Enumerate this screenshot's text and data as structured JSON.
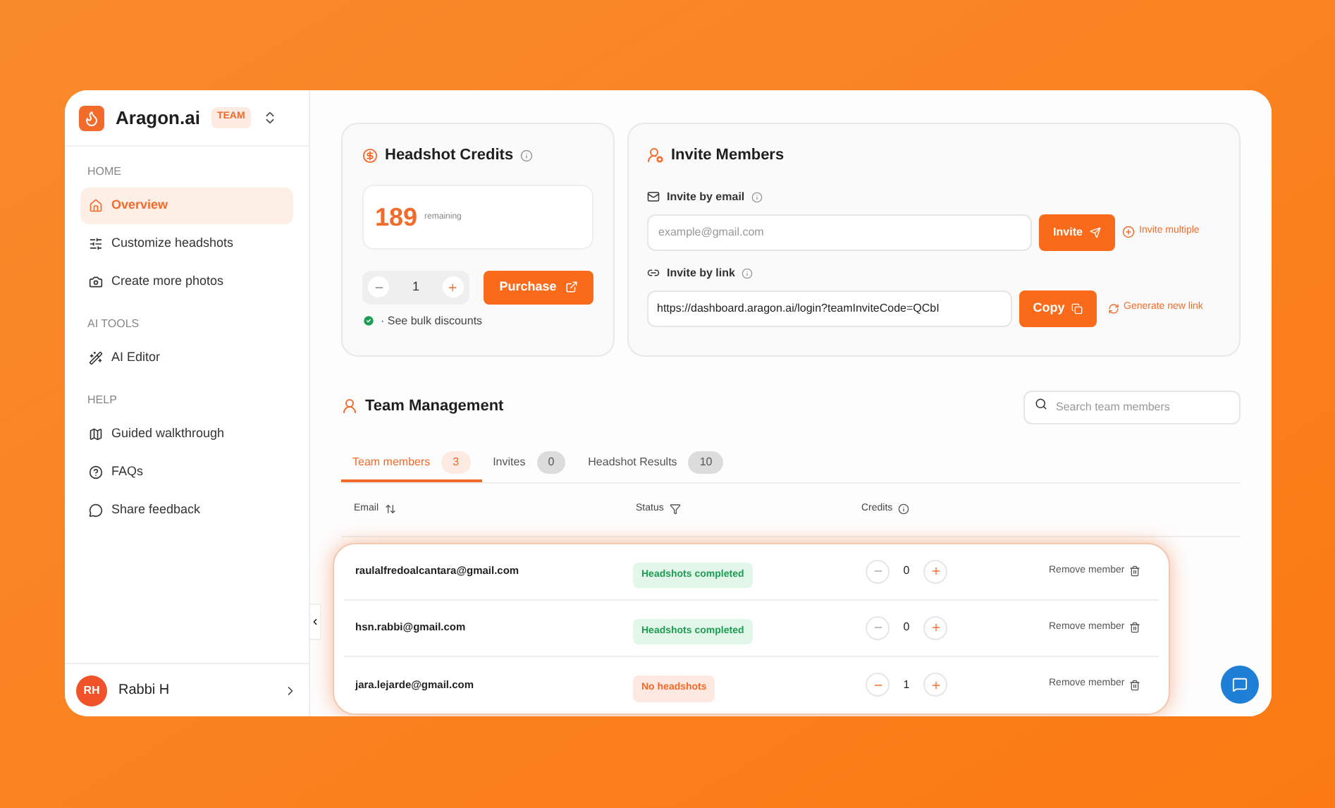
{
  "sidebar": {
    "brand": "Aragon.ai",
    "plan_badge": "TEAM",
    "sections": [
      {
        "heading": "HOME",
        "items": [
          {
            "label": "Overview",
            "selected": true
          },
          {
            "label": "Customize headshots",
            "selected": false
          },
          {
            "label": "Create more photos",
            "selected": false
          }
        ]
      },
      {
        "heading": "AI TOOLS",
        "items": [
          {
            "label": "AI Editor",
            "selected": false
          }
        ]
      },
      {
        "heading": "HELP",
        "items": [
          {
            "label": "Guided walkthrough",
            "selected": false
          },
          {
            "label": "FAQs",
            "selected": false
          },
          {
            "label": "Share feedback",
            "selected": false
          }
        ]
      }
    ],
    "user": {
      "initials": "RH",
      "name": "Rabbi H"
    }
  },
  "credits_card": {
    "title": "Headshot Credits",
    "count": "189",
    "count_label": "remaining",
    "quantity": "1",
    "purchase": "Purchase",
    "bulk_link": "· See bulk discounts"
  },
  "invite_card": {
    "title": "Invite Members",
    "email_label": "Invite by email",
    "email_placeholder": "example@gmail.com",
    "invite_button": "Invite",
    "invite_multiple": "Invite multiple",
    "link_label": "Invite by link",
    "link_value": "https://dashboard.aragon.ai/login?teamInviteCode=QCbI",
    "copy_button": "Copy",
    "generate_link": "Generate new link"
  },
  "team": {
    "title": "Team Management",
    "search_placeholder": "Search team members",
    "tabs": [
      {
        "label": "Team members",
        "count": "3",
        "selected": true
      },
      {
        "label": "Invites",
        "count": "0",
        "selected": false
      },
      {
        "label": "Headshot Results",
        "count": "10",
        "selected": false
      }
    ],
    "columns": [
      "Email",
      "Status",
      "Credits"
    ],
    "rows": [
      {
        "email": "raulalfredoalcantara@gmail.com",
        "status": "Headshots completed",
        "kind": "completed",
        "credits": "0",
        "can_decrease": false,
        "action": "Remove member"
      },
      {
        "email": "hsn.rabbi@gmail.com",
        "status": "Headshots completed",
        "kind": "completed",
        "credits": "0",
        "can_decrease": false,
        "action": "Remove member"
      },
      {
        "email": "jara.lejarde@gmail.com",
        "status": "No headshots",
        "kind": "none",
        "credits": "1",
        "can_decrease": true,
        "action": "Remove member"
      }
    ]
  }
}
